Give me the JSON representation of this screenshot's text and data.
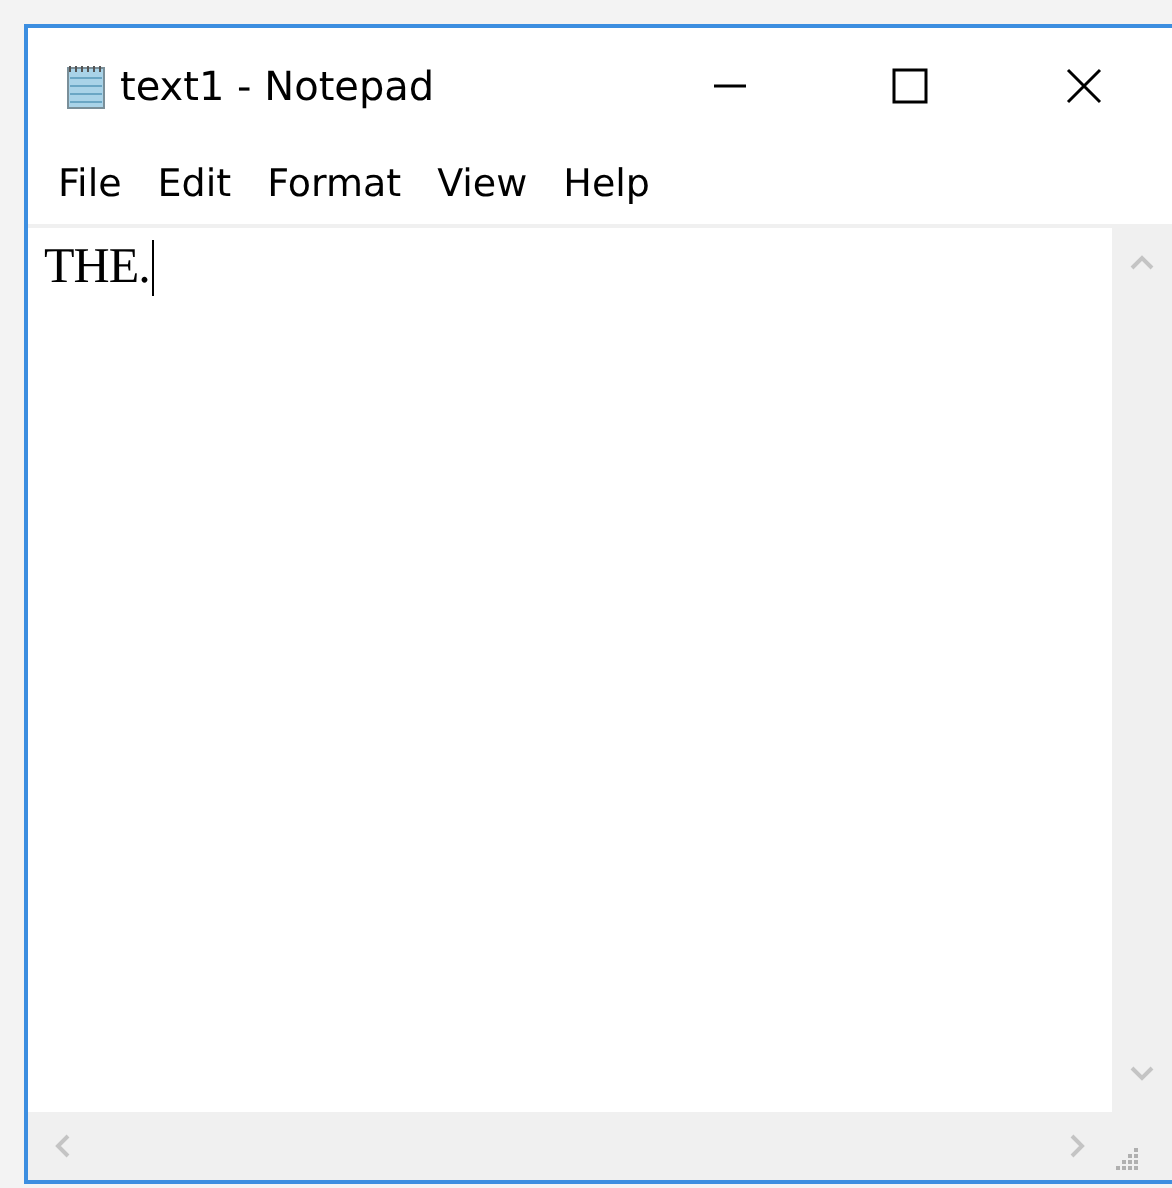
{
  "window": {
    "title": "text1 - Notepad"
  },
  "menu": [
    {
      "label": "File"
    },
    {
      "label": "Edit"
    },
    {
      "label": "Format"
    },
    {
      "label": "View"
    },
    {
      "label": "Help"
    }
  ],
  "editor": {
    "value": "THE."
  }
}
